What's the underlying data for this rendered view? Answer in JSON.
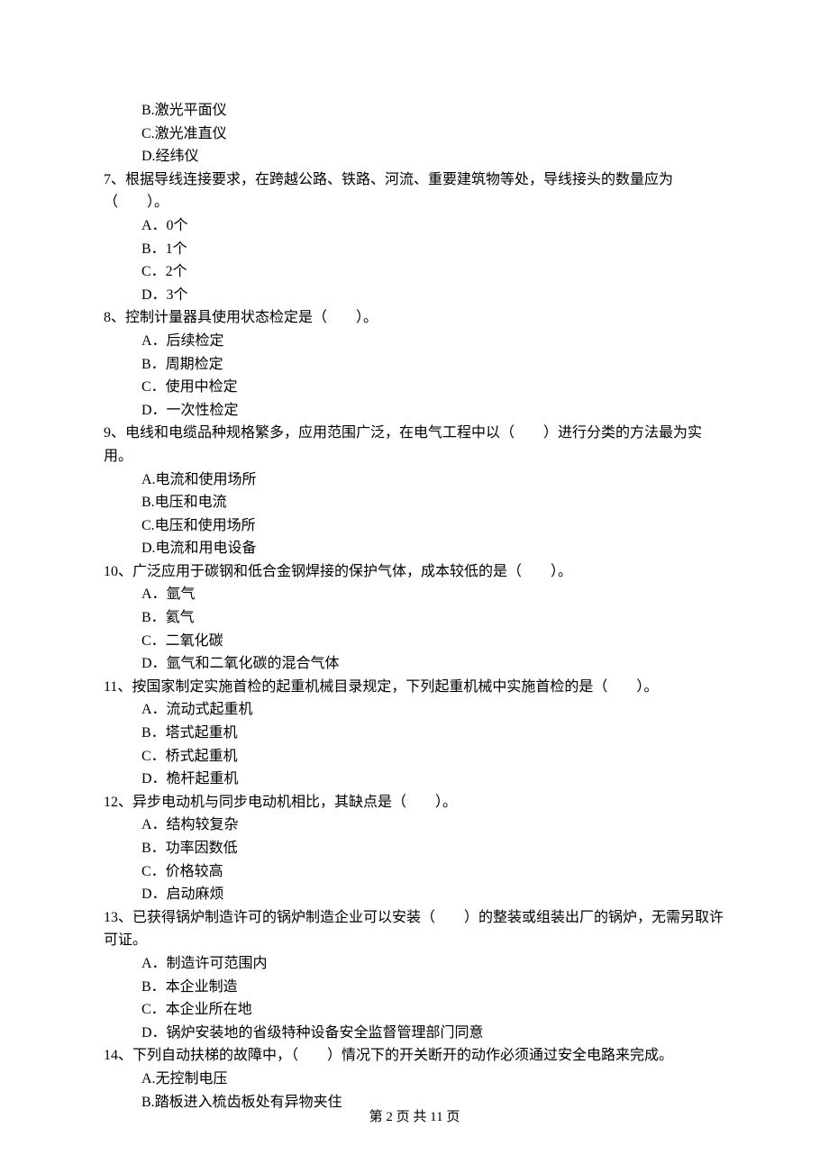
{
  "leadOptions": [
    "B.激光平面仪",
    "C.激光准直仪",
    "D.经纬仪"
  ],
  "questions": [
    {
      "stem": "7、根据导线连接要求，在跨越公路、铁路、河流、重要建筑物等处，导线接头的数量应为（　　）。",
      "options": [
        "A．0个",
        "B．1个",
        "C．2个",
        "D．3个"
      ]
    },
    {
      "stem": "8、控制计量器具使用状态检定是（　　）。",
      "options": [
        "A．后续检定",
        "B．周期检定",
        "C．使用中检定",
        "D．一次性检定"
      ]
    },
    {
      "stem": "9、电线和电缆品种规格繁多，应用范围广泛，在电气工程中以（　　）进行分类的方法最为实用。",
      "options": [
        "A.电流和使用场所",
        "B.电压和电流",
        "C.电压和使用场所",
        "D.电流和用电设备"
      ]
    },
    {
      "stem": "10、广泛应用于碳钢和低合金钢焊接的保护气体，成本较低的是（　　）。",
      "options": [
        "A．氩气",
        "B．氦气",
        "C．二氧化碳",
        "D．氩气和二氧化碳的混合气体"
      ]
    },
    {
      "stem": "11、按国家制定实施首检的起重机械目录规定，下列起重机械中实施首检的是（　　）。",
      "options": [
        "A．流动式起重机",
        "B．塔式起重机",
        "C．桥式起重机",
        "D．桅杆起重机"
      ]
    },
    {
      "stem": "12、异步电动机与同步电动机相比，其缺点是（　　）。",
      "options": [
        "A．结构较复杂",
        "B．功率因数低",
        "C．价格较高",
        "D．启动麻烦"
      ]
    },
    {
      "stem": "13、已获得锅炉制造许可的锅炉制造企业可以安装（　　）的整装或组装出厂的锅炉，无需另取许可证。",
      "options": [
        "A．制造许可范围内",
        "B．本企业制造",
        "C．本企业所在地",
        "D．锅炉安装地的省级特种设备安全监督管理部门同意"
      ]
    },
    {
      "stem": "14、下列自动扶梯的故障中，（　　）情况下的开关断开的动作必须通过安全电路来完成。",
      "options": [
        "A.无控制电压",
        "B.踏板进入梳齿板处有异物夹住"
      ]
    }
  ],
  "footer": "第 2 页 共 11 页"
}
